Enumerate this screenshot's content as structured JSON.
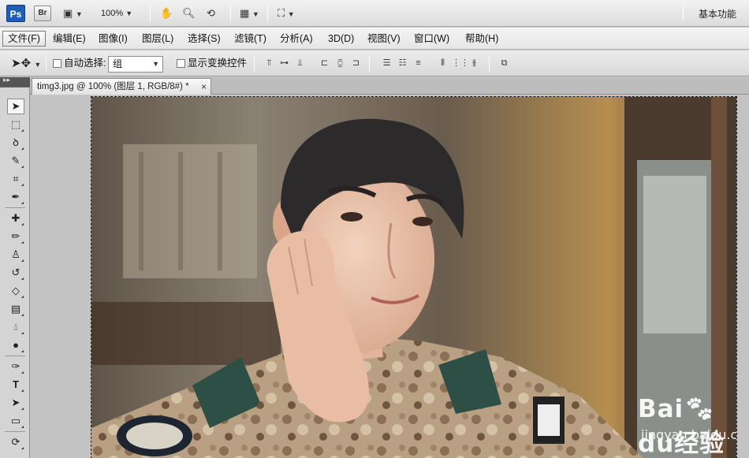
{
  "app": {
    "logo": "Ps",
    "bridge": "Br",
    "zoom": "100%",
    "workspace": "基本功能"
  },
  "menu": {
    "items": [
      "文件(F)",
      "编辑(E)",
      "图像(I)",
      "图层(L)",
      "选择(S)",
      "滤镜(T)",
      "分析(A)",
      "3D(D)",
      "视图(V)",
      "窗口(W)",
      "帮助(H)"
    ]
  },
  "options": {
    "auto_select_label": "自动选择:",
    "auto_select_value": "组",
    "show_transform_label": "显示变换控件"
  },
  "document": {
    "tab_title": "timg3.jpg @ 100% (图层 1, RGB/8#) *",
    "close": "×"
  },
  "watermark": {
    "brand": "Bai",
    "brand_suffix": "du",
    "product": "经验",
    "url": "jingyan.baidu.com"
  },
  "colors": {
    "ps_blue": "#1f5fb3",
    "canvas_bg": "#c3c3c3",
    "uniform_camo": "#b9a083",
    "collar_patch": "#2d4f45"
  }
}
